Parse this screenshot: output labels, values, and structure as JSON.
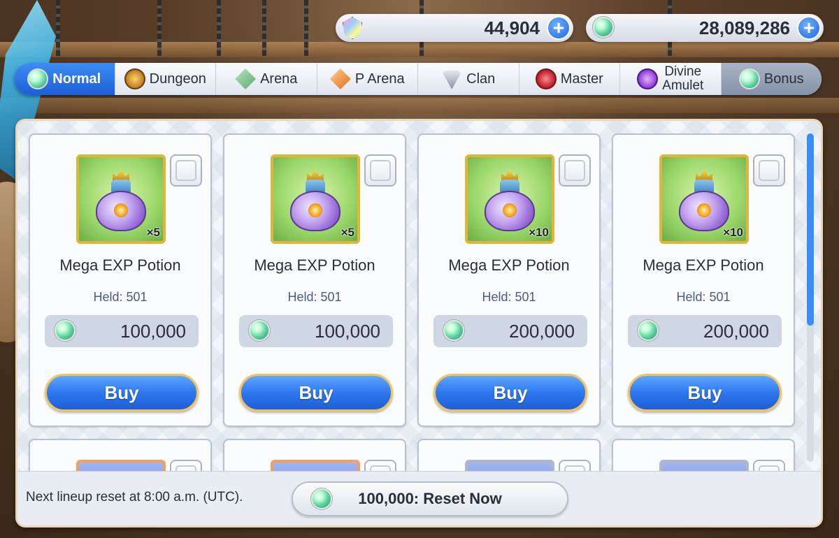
{
  "currencies": [
    {
      "icon": "jewel-crystal-icon",
      "amount": "44,904"
    },
    {
      "icon": "mana-gem-icon",
      "amount": "28,089,286"
    }
  ],
  "tabs": [
    {
      "label": "Normal",
      "active": true
    },
    {
      "label": "Dungeon"
    },
    {
      "label": "Arena"
    },
    {
      "label": "P Arena"
    },
    {
      "label": "Clan"
    },
    {
      "label": "Master"
    },
    {
      "label_line1": "Divine",
      "label_line2": "Amulet"
    },
    {
      "label": "Bonus"
    }
  ],
  "items": [
    {
      "name": "Mega EXP Potion",
      "qty": "×5",
      "held": "Held: 501",
      "price": "100,000",
      "buy_label": "Buy"
    },
    {
      "name": "Mega EXP Potion",
      "qty": "×5",
      "held": "Held: 501",
      "price": "100,000",
      "buy_label": "Buy"
    },
    {
      "name": "Mega EXP Potion",
      "qty": "×10",
      "held": "Held: 501",
      "price": "200,000",
      "buy_label": "Buy"
    },
    {
      "name": "Mega EXP Potion",
      "qty": "×10",
      "held": "Held: 501",
      "price": "200,000",
      "buy_label": "Buy"
    }
  ],
  "footer": {
    "reset_text": "Next lineup reset at 8:00 a.m. (UTC).",
    "reset_button": "100,000: Reset Now"
  },
  "colors": {
    "accent_blue": "#2f78f0",
    "gold_border": "#e3b43a",
    "panel_bg": "#f3f5f9"
  }
}
